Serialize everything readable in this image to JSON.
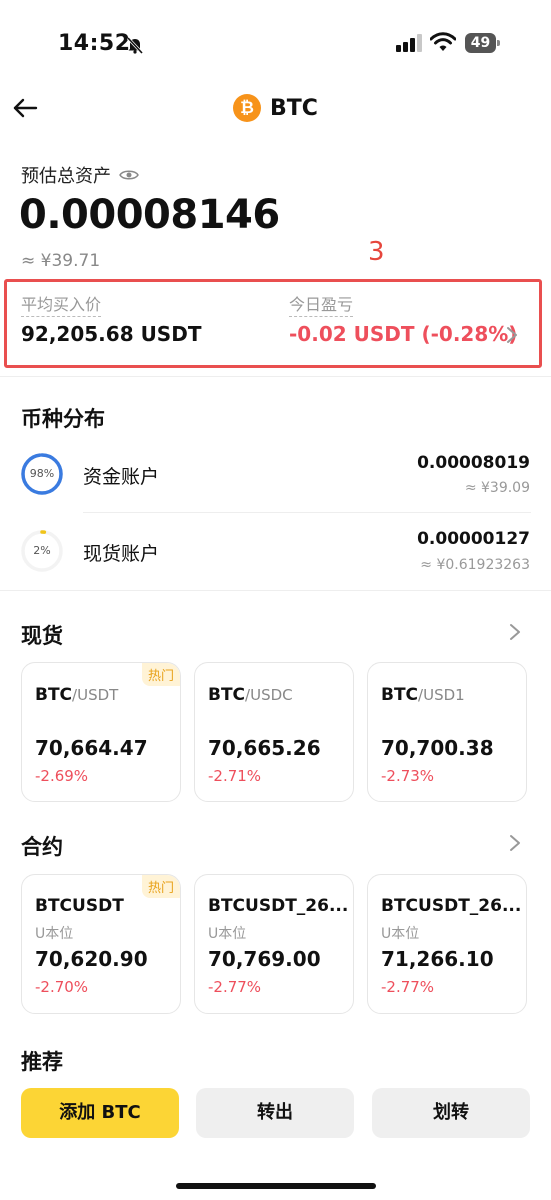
{
  "status_bar": {
    "time": "14:52",
    "battery": "49"
  },
  "header": {
    "title": "BTC",
    "coin_symbol": "₿"
  },
  "assets": {
    "label": "预估总资产",
    "total": "0.00008146",
    "cny": "≈ ¥39.71",
    "annotation": "3",
    "avg_price_label": "平均买入价",
    "avg_price_value": "92,205.68 USDT",
    "today_pnl_label": "今日盈亏",
    "today_pnl_value": "-0.02 USDT (-0.28%)"
  },
  "distribution": {
    "title": "币种分布",
    "items": [
      {
        "percent_label": "98%",
        "percent": 0.98,
        "name": "资金账户",
        "amount": "0.00008019",
        "cny": "≈ ¥39.09"
      },
      {
        "percent_label": "2%",
        "percent": 0.02,
        "name": "现货账户",
        "amount": "0.00000127",
        "cny": "≈ ¥0.61923263"
      }
    ]
  },
  "spot": {
    "title": "现货",
    "cards": [
      {
        "base": "BTC",
        "quote": "/USDT",
        "price": "70,664.47",
        "change": "-2.69%",
        "badge": "热门"
      },
      {
        "base": "BTC",
        "quote": "/USDC",
        "price": "70,665.26",
        "change": "-2.71%"
      },
      {
        "base": "BTC",
        "quote": "/USD1",
        "price": "70,700.38",
        "change": "-2.73%"
      }
    ]
  },
  "futures": {
    "title": "合约",
    "cards": [
      {
        "name": "BTCUSDT",
        "sub": "U本位",
        "price": "70,620.90",
        "change": "-2.70%",
        "badge": "热门"
      },
      {
        "name": "BTCUSDT_26...",
        "sub": "U本位",
        "price": "70,769.00",
        "change": "-2.77%"
      },
      {
        "name": "BTCUSDT_26...",
        "sub": "U本位",
        "price": "71,266.10",
        "change": "-2.77%"
      }
    ]
  },
  "recommend": {
    "title": "推荐",
    "buttons": {
      "add": "添加 BTC",
      "transfer_out": "转出",
      "transfer": "划转"
    }
  },
  "colors": {
    "accent": "#FCD535",
    "negative": "#EE4F5C",
    "ring_primary": "#3A7BE0",
    "ring_small": "#F0C419",
    "highlight_box": "#E94F4F"
  }
}
